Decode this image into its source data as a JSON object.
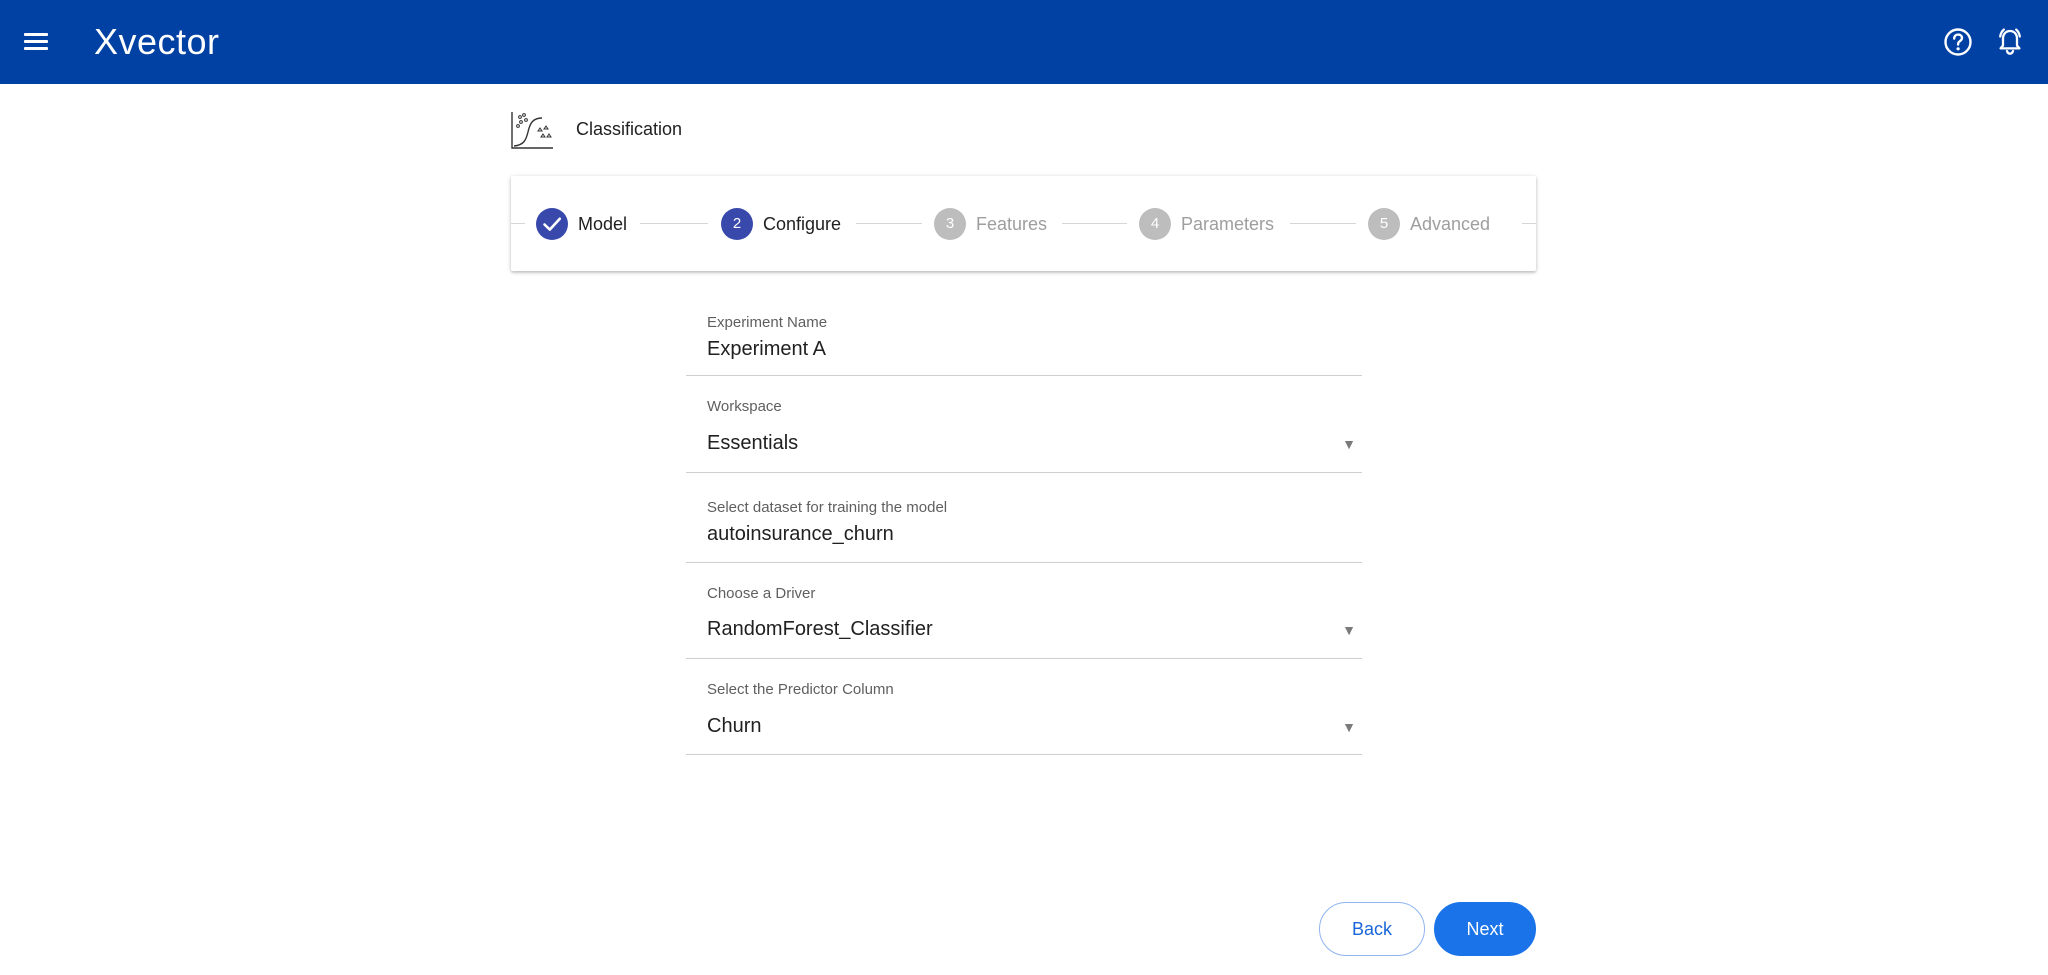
{
  "app": {
    "brand": "Xvector",
    "page_title": "Classification"
  },
  "stepper": {
    "steps": [
      {
        "number": "",
        "label": "Model",
        "state": "completed"
      },
      {
        "number": "2",
        "label": "Configure",
        "state": "active"
      },
      {
        "number": "3",
        "label": "Features",
        "state": "pending"
      },
      {
        "number": "4",
        "label": "Parameters",
        "state": "pending"
      },
      {
        "number": "5",
        "label": "Advanced",
        "state": "pending"
      }
    ]
  },
  "form": {
    "experiment_name": {
      "label": "Experiment Name",
      "value": "Experiment A"
    },
    "workspace": {
      "label": "Workspace",
      "value": "Essentials"
    },
    "dataset": {
      "label": "Select dataset for training the model",
      "value": "autoinsurance_churn"
    },
    "driver": {
      "label": "Choose a Driver",
      "value": "RandomForest_Classifier"
    },
    "predictor": {
      "label": "Select the Predictor Column",
      "value": "Churn"
    }
  },
  "actions": {
    "back_label": "Back",
    "next_label": "Next"
  },
  "colors": {
    "topbar": "#0041a3",
    "step_active": "#3949ab",
    "step_pending": "#bdbdbd",
    "primary_button": "#1a73e8"
  },
  "icons": {
    "menu": "menu-icon",
    "help": "help-circle-icon",
    "notifications": "bell-alert-icon",
    "page": "classification-chart-icon",
    "completed_step": "check-icon",
    "dropdown": "caret-down-icon"
  }
}
